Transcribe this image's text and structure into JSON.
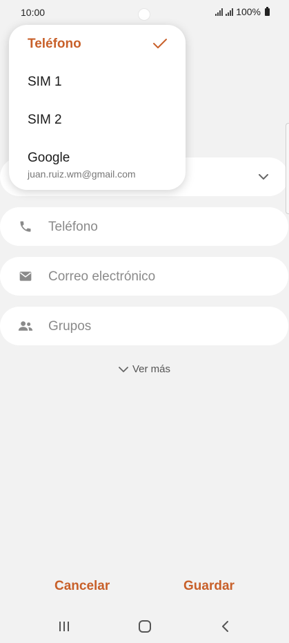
{
  "status_bar": {
    "time": "10:00",
    "battery": "100%"
  },
  "popup": {
    "items": [
      {
        "label": "Teléfono",
        "selected": true
      },
      {
        "label": "SIM 1"
      },
      {
        "label": "SIM 2"
      },
      {
        "label": "Google",
        "sublabel": "juan.ruiz.wm@gmail.com"
      }
    ]
  },
  "fields": {
    "phone": {
      "placeholder": "Teléfono",
      "icon": "phone-icon"
    },
    "email": {
      "placeholder": "Correo electrónico",
      "icon": "envelope-icon"
    },
    "groups": {
      "placeholder": "Grupos",
      "icon": "people-icon"
    }
  },
  "see_more": "Ver más",
  "actions": {
    "cancel": "Cancelar",
    "save": "Guardar"
  },
  "colors": {
    "accent": "#c8602a",
    "background": "#f2f2f2",
    "surface": "#ffffff"
  }
}
